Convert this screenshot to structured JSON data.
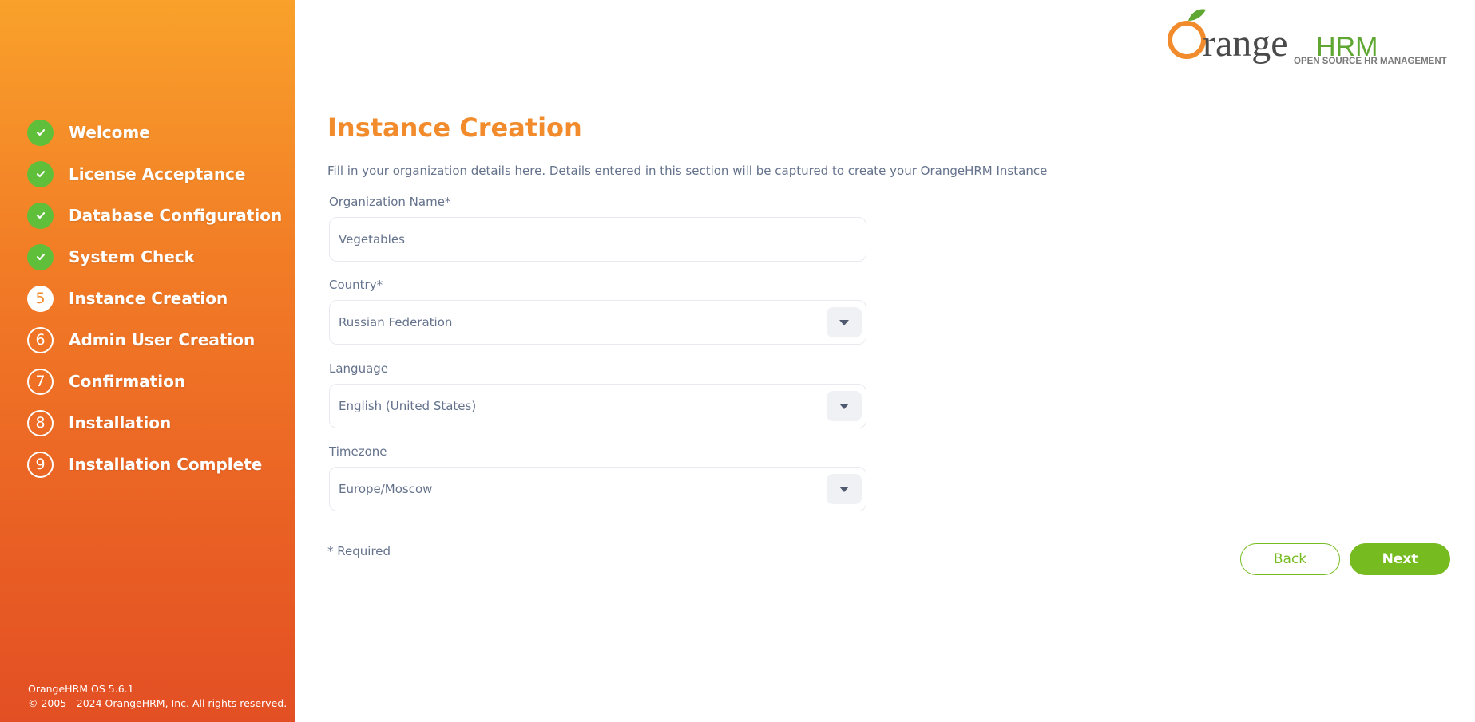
{
  "sidebar": {
    "steps": [
      {
        "label": "Welcome",
        "status": "done"
      },
      {
        "label": "License Acceptance",
        "status": "done"
      },
      {
        "label": "Database Configuration",
        "status": "done"
      },
      {
        "label": "System Check",
        "status": "done"
      },
      {
        "label": "Instance Creation",
        "status": "current",
        "number": "5"
      },
      {
        "label": "Admin User Creation",
        "status": "todo",
        "number": "6"
      },
      {
        "label": "Confirmation",
        "status": "todo",
        "number": "7"
      },
      {
        "label": "Installation",
        "status": "todo",
        "number": "8"
      },
      {
        "label": "Installation Complete",
        "status": "todo",
        "number": "9"
      }
    ],
    "footer": {
      "version": "OrangeHRM OS 5.6.1",
      "copyright": "© 2005 - 2024 OrangeHRM, Inc. All rights reserved."
    }
  },
  "logo": {
    "brand_main": "range",
    "brand_hrm": "HRM",
    "brand_initial": "O",
    "tagline": "OPEN SOURCE HR MANAGEMENT"
  },
  "main": {
    "title": "Instance Creation",
    "description": "Fill in your organization details here. Details entered in this section will be captured to create your OrangeHRM Instance",
    "fields": {
      "org_name": {
        "label": "Organization Name*",
        "value": "Vegetables"
      },
      "country": {
        "label": "Country*",
        "value": "Russian Federation"
      },
      "language": {
        "label": "Language",
        "value": "English (United States)"
      },
      "timezone": {
        "label": "Timezone",
        "value": "Europe/Moscow"
      }
    },
    "required_note": "* Required",
    "buttons": {
      "back": "Back",
      "next": "Next"
    }
  },
  "colors": {
    "accent": "#f28b2c",
    "done_green": "#5fbf3a",
    "button_green": "#76bc21",
    "text_muted": "#64728c"
  }
}
